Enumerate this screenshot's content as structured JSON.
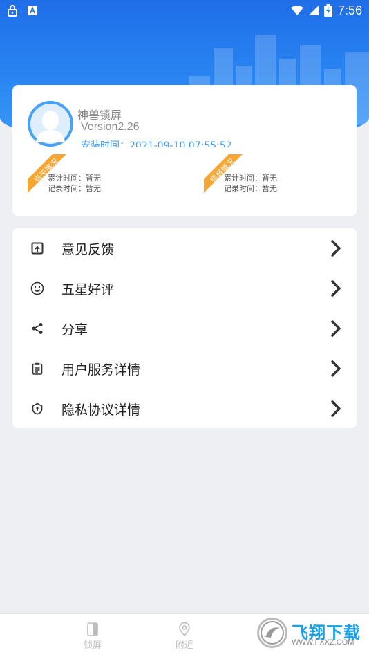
{
  "status_bar": {
    "time": "7:56"
  },
  "profile": {
    "app_name": "神兽锁屏",
    "version": "Version2.26",
    "install_time": "安装时间：2021-09-10 07:55:52"
  },
  "stats": [
    {
      "ribbon": "当天情况",
      "total_label": "累计时间：暂无",
      "record_label": "记录时间：暂无"
    },
    {
      "ribbon": "锁屏情况",
      "total_label": "累计时间：暂无",
      "record_label": "记录时间：暂无"
    }
  ],
  "menu": [
    {
      "icon": "feedback-icon",
      "label": "意见反馈"
    },
    {
      "icon": "smile-icon",
      "label": "五星好评"
    },
    {
      "icon": "share-icon",
      "label": "分享"
    },
    {
      "icon": "clipboard-icon",
      "label": "用户服务详情"
    },
    {
      "icon": "shield-icon",
      "label": "隐私协议详情"
    }
  ],
  "bottom_nav": [
    {
      "icon": "lock-screen-icon",
      "label": "锁屏"
    },
    {
      "icon": "location-pin-icon",
      "label": "附近"
    }
  ],
  "watermark": {
    "title": "飞翔下载",
    "url": "WWW.FXXZ.COM"
  },
  "colors": {
    "primary": "#2a86f2",
    "ribbon": "#f6a632",
    "accent_text": "#3f9ef7"
  }
}
